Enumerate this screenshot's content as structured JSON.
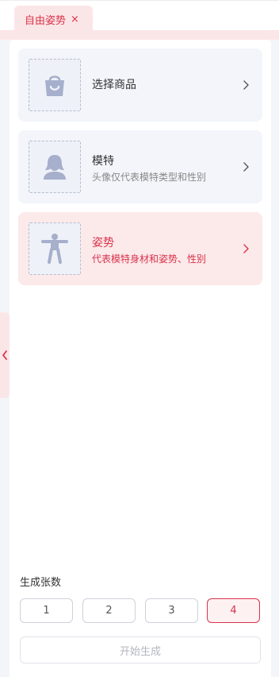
{
  "tab": {
    "label": "自由姿势",
    "close_symbol": "×",
    "accent": "#d9334a"
  },
  "cards": [
    {
      "title": "选择商品",
      "subtitle": "",
      "icon": "shopping-bag-icon"
    },
    {
      "title": "模特",
      "subtitle": "头像仅代表模特类型和性别",
      "icon": "person-silhouette-icon"
    },
    {
      "title": "姿势",
      "subtitle": "代表模特身材和姿势、性别",
      "icon": "pose-figure-icon",
      "active": true
    }
  ],
  "generation": {
    "label": "生成张数",
    "options": [
      "1",
      "2",
      "3",
      "4"
    ],
    "selected": "4"
  },
  "start_button": {
    "label": "开始生成"
  }
}
